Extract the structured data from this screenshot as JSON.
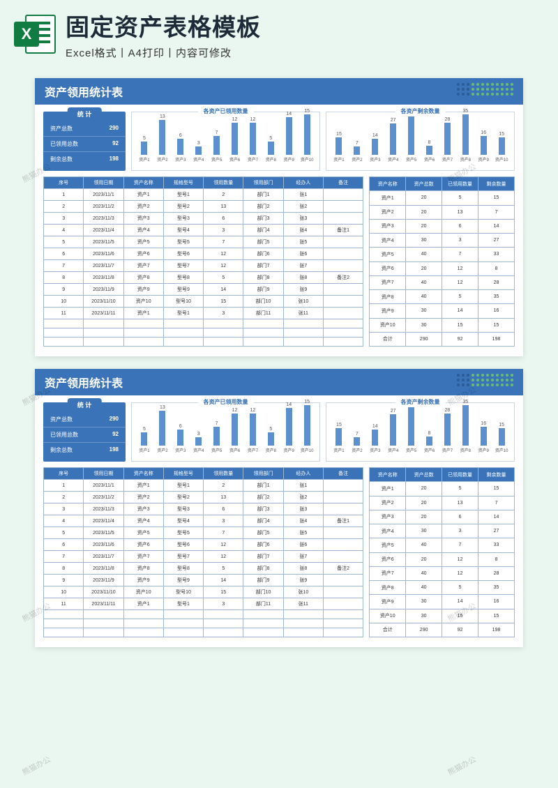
{
  "header": {
    "title": "固定资产表格模板",
    "subtitle": "Excel格式丨A4打印丨内容可修改",
    "icon_letter": "X"
  },
  "sheet": {
    "banner_title": "资产领用统计表",
    "stat": {
      "tab": "统 计",
      "rows": [
        {
          "label": "资产总数",
          "value": "290"
        },
        {
          "label": "已领用总数",
          "value": "92"
        },
        {
          "label": "剩余总数",
          "value": "198"
        }
      ]
    },
    "chart1": {
      "title": "各资产已领用数量",
      "max": 15,
      "bars": [
        {
          "label": "资产1",
          "value": 5
        },
        {
          "label": "资产2",
          "value": 13
        },
        {
          "label": "资产3",
          "value": 6
        },
        {
          "label": "资产4",
          "value": 3
        },
        {
          "label": "资产5",
          "value": 7
        },
        {
          "label": "资产6",
          "value": 12
        },
        {
          "label": "资产7",
          "value": 12
        },
        {
          "label": "资产8",
          "value": 5
        },
        {
          "label": "资产9",
          "value": 14
        },
        {
          "label": "资产10",
          "value": 15
        }
      ]
    },
    "chart2": {
      "title": "各资产剩余数量",
      "max": 35,
      "bars": [
        {
          "label": "资产1",
          "value": 15
        },
        {
          "label": "资产2",
          "value": 7
        },
        {
          "label": "资产3",
          "value": 14
        },
        {
          "label": "资产4",
          "value": 27
        },
        {
          "label": "资产5",
          "value": 33
        },
        {
          "label": "资产6",
          "value": 8
        },
        {
          "label": "资产7",
          "value": 28
        },
        {
          "label": "资产8",
          "value": 35
        },
        {
          "label": "资产9",
          "value": 16
        },
        {
          "label": "资产10",
          "value": 15
        }
      ]
    },
    "table_left": {
      "headers": [
        "序号",
        "领用日期",
        "资产名称",
        "规格型号",
        "领用数量",
        "领用部门",
        "经办人",
        "备注"
      ],
      "rows": [
        [
          "1",
          "2023/11/1",
          "资产1",
          "型号1",
          "2",
          "部门1",
          "张1",
          ""
        ],
        [
          "2",
          "2023/11/2",
          "资产2",
          "型号2",
          "13",
          "部门2",
          "张2",
          ""
        ],
        [
          "3",
          "2023/11/3",
          "资产3",
          "型号3",
          "6",
          "部门3",
          "张3",
          ""
        ],
        [
          "4",
          "2023/11/4",
          "资产4",
          "型号4",
          "3",
          "部门4",
          "张4",
          "备注1"
        ],
        [
          "5",
          "2023/11/5",
          "资产5",
          "型号5",
          "7",
          "部门5",
          "张5",
          ""
        ],
        [
          "6",
          "2023/11/6",
          "资产6",
          "型号6",
          "12",
          "部门6",
          "张6",
          ""
        ],
        [
          "7",
          "2023/11/7",
          "资产7",
          "型号7",
          "12",
          "部门7",
          "张7",
          ""
        ],
        [
          "8",
          "2023/11/8",
          "资产8",
          "型号8",
          "5",
          "部门8",
          "张8",
          "备注2"
        ],
        [
          "9",
          "2023/11/9",
          "资产9",
          "型号9",
          "14",
          "部门9",
          "张9",
          ""
        ],
        [
          "10",
          "2023/11/10",
          "资产10",
          "型号10",
          "15",
          "部门10",
          "张10",
          ""
        ],
        [
          "11",
          "2023/11/11",
          "资产1",
          "型号1",
          "3",
          "部门11",
          "张11",
          ""
        ]
      ],
      "empty_rows": 3
    },
    "table_right": {
      "headers": [
        "资产名称",
        "资产总数",
        "已领用数量",
        "剩余数量"
      ],
      "rows": [
        [
          "资产1",
          "20",
          "5",
          "15"
        ],
        [
          "资产2",
          "20",
          "13",
          "7"
        ],
        [
          "资产3",
          "20",
          "6",
          "14"
        ],
        [
          "资产4",
          "30",
          "3",
          "27"
        ],
        [
          "资产5",
          "40",
          "7",
          "33"
        ],
        [
          "资产6",
          "20",
          "12",
          "8"
        ],
        [
          "资产7",
          "40",
          "12",
          "28"
        ],
        [
          "资产8",
          "40",
          "5",
          "35"
        ],
        [
          "资产9",
          "30",
          "14",
          "16"
        ],
        [
          "资产10",
          "30",
          "15",
          "15"
        ],
        [
          "合计",
          "290",
          "92",
          "198"
        ]
      ]
    }
  },
  "chart_data": [
    {
      "type": "bar",
      "title": "各资产已领用数量",
      "categories": [
        "资产1",
        "资产2",
        "资产3",
        "资产4",
        "资产5",
        "资产6",
        "资产7",
        "资产8",
        "资产9",
        "资产10"
      ],
      "values": [
        5,
        13,
        6,
        3,
        7,
        12,
        12,
        5,
        14,
        15
      ],
      "xlabel": "",
      "ylabel": "",
      "ylim": [
        0,
        15
      ]
    },
    {
      "type": "bar",
      "title": "各资产剩余数量",
      "categories": [
        "资产1",
        "资产2",
        "资产3",
        "资产4",
        "资产5",
        "资产6",
        "资产7",
        "资产8",
        "资产9",
        "资产10"
      ],
      "values": [
        15,
        7,
        14,
        27,
        33,
        8,
        28,
        35,
        16,
        15
      ],
      "xlabel": "",
      "ylabel": "",
      "ylim": [
        0,
        35
      ]
    }
  ],
  "watermark": "熊猫办公"
}
